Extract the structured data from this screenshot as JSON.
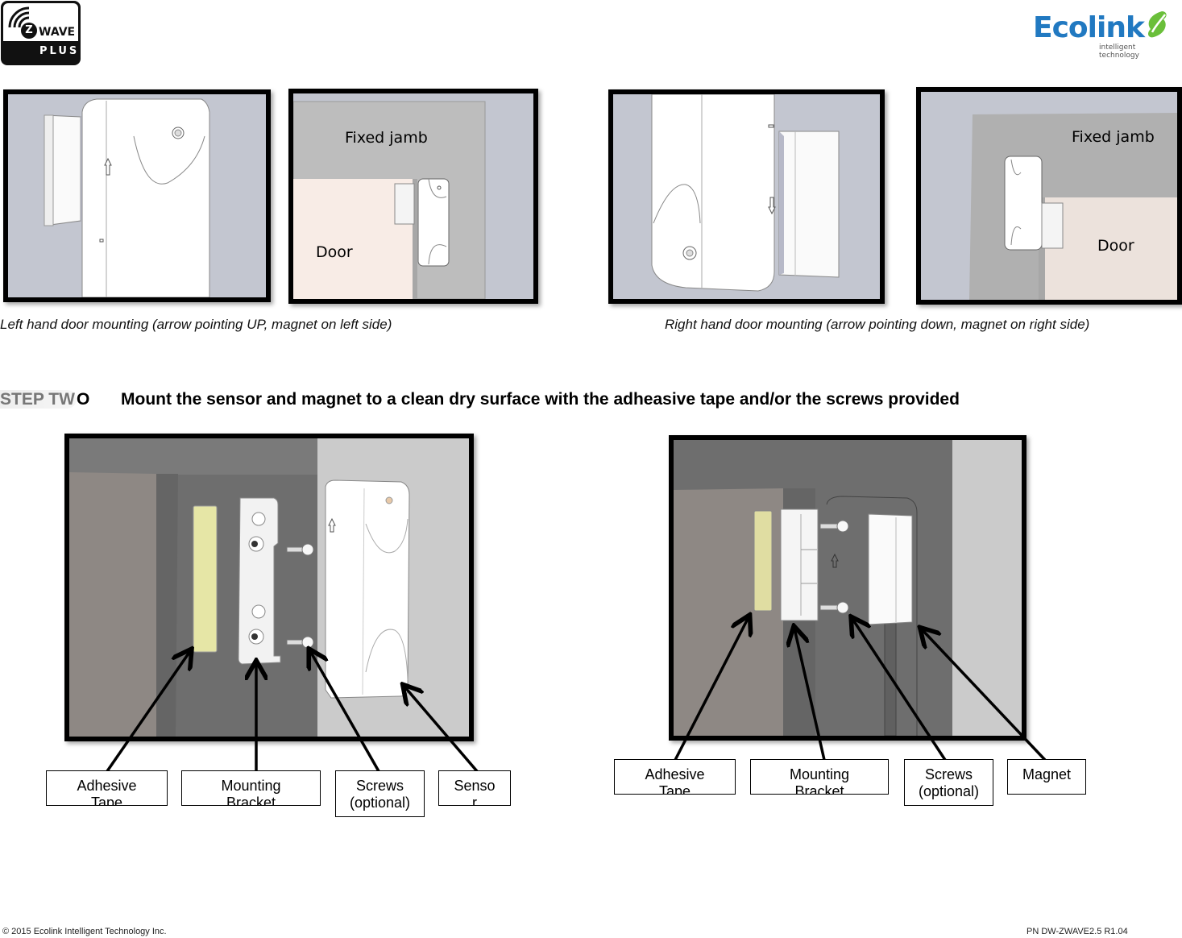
{
  "logos": {
    "zwave": {
      "letter": "Z",
      "word": "WAVE",
      "plus": "PLUS"
    },
    "ecolink": {
      "word": "Ecolink",
      "tagline": "intelligent technology",
      "brand_color": "#2179c1",
      "leaf_color": "#6abf3a"
    }
  },
  "step_one_images": {
    "left_hand": {
      "jamb_label": "Fixed jamb",
      "door_label": "Door",
      "caption": "Left hand door mounting (arrow pointing UP, magnet on left side)"
    },
    "right_hand": {
      "jamb_label": "Fixed jamb",
      "door_label": "Door",
      "caption": "Right hand door mounting (arrow pointing down, magnet on right side)"
    }
  },
  "step_two": {
    "label_faded": "STEP TW",
    "label_tail": "O",
    "title": "Mount the sensor and magnet to a clean dry surface with the adheasive tape and/or the screws provided"
  },
  "sensor_diagram": {
    "callouts": [
      {
        "line1": "Adhesive",
        "line2": "Tape"
      },
      {
        "line1": "Mounting",
        "line2": "Bracket"
      },
      {
        "line1": "Screws",
        "line2": "(optional)"
      },
      {
        "line1": "Senso",
        "line2": "r"
      }
    ]
  },
  "magnet_diagram": {
    "callouts": [
      {
        "line1": "Adhesive",
        "line2": "Tape"
      },
      {
        "line1": "Mounting",
        "line2": "Bracket"
      },
      {
        "line1": "Screws",
        "line2": "(optional)"
      },
      {
        "line1": "Magnet",
        "line2": ""
      }
    ]
  },
  "colors": {
    "tape": "#e6e6a6",
    "door_pink": "#f8ece6",
    "jamb_gray": "#bdbdbd",
    "background_blue_gray": "#c3c6d0"
  },
  "footer": {
    "copyright": "© 2015 Ecolink Intelligent Technology Inc.",
    "part_number": "PN DW-ZWAVE2.5  R1.04"
  }
}
